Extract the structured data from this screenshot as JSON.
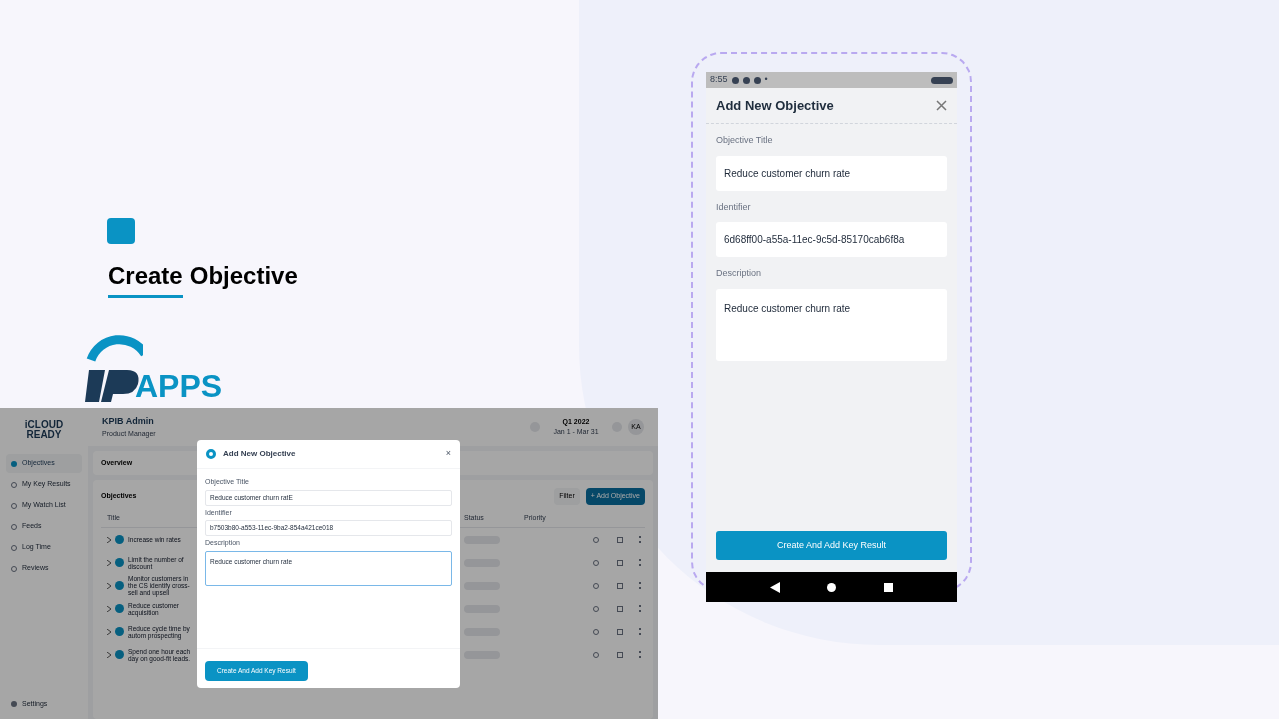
{
  "heading": {
    "first_word": "Create",
    "rest": "Objective"
  },
  "brand": {
    "logo_text": "APPS"
  },
  "desktop": {
    "logo": {
      "small": "i",
      "main": "CLOUD",
      "sub": "READY"
    },
    "header": {
      "title": "KPIB Admin",
      "subtitle": "Product Manager",
      "period": "Q1 2022",
      "period_range": "Jan 1 - Mar 31",
      "avatar": "KA"
    },
    "sidebar": [
      {
        "label": "Objectives",
        "selected": true
      },
      {
        "label": "My Key Results",
        "selected": false
      },
      {
        "label": "My Watch List",
        "selected": false
      },
      {
        "label": "Feeds",
        "selected": false
      },
      {
        "label": "Log Time",
        "selected": false
      },
      {
        "label": "Reviews",
        "selected": false
      }
    ],
    "settings": "Settings",
    "overview": "Overview",
    "objectives_title": "Objectives",
    "filter": "Filter",
    "add_button": "+ Add Objective",
    "columns": [
      "Title",
      "Status",
      "Priority"
    ],
    "rows": [
      {
        "title": "Increase win rates"
      },
      {
        "title": "Limit the number of discount"
      },
      {
        "title": "Monitor customers in the CS identify cross-sell and upsell"
      },
      {
        "title": "Reduce customer acquisition"
      },
      {
        "title": "Reduce cycle time by autom prospecting"
      },
      {
        "title": "Spend one hour each day on good-fit leads."
      }
    ],
    "modal": {
      "title": "Add New Objective",
      "close": "×",
      "fields": [
        {
          "label": "Objective Title",
          "value": "Reduce customer churn ratE",
          "kind": "input",
          "focused": false
        },
        {
          "label": "Identifier",
          "value": "b7503b80-a553-11ec-9ba2-854a421ce018",
          "kind": "input",
          "focused": false
        },
        {
          "label": "Description",
          "value": "Reduce customer churn rate",
          "kind": "textarea",
          "focused": true
        }
      ],
      "submit": "Create And Add Key Result"
    }
  },
  "phone": {
    "time": "8:55",
    "dot": "•",
    "modal": {
      "title": "Add New Objective",
      "fields": [
        {
          "label": "Objective Title",
          "value": "Reduce customer churn rate",
          "kind": "input"
        },
        {
          "label": "Identifier",
          "value": "6d68ff00-a55a-11ec-9c5d-85170cab6f8a",
          "kind": "input"
        },
        {
          "label": "Description",
          "value": "Reduce customer churn rate",
          "kind": "textarea"
        }
      ],
      "submit": "Create And Add Key Result"
    }
  }
}
